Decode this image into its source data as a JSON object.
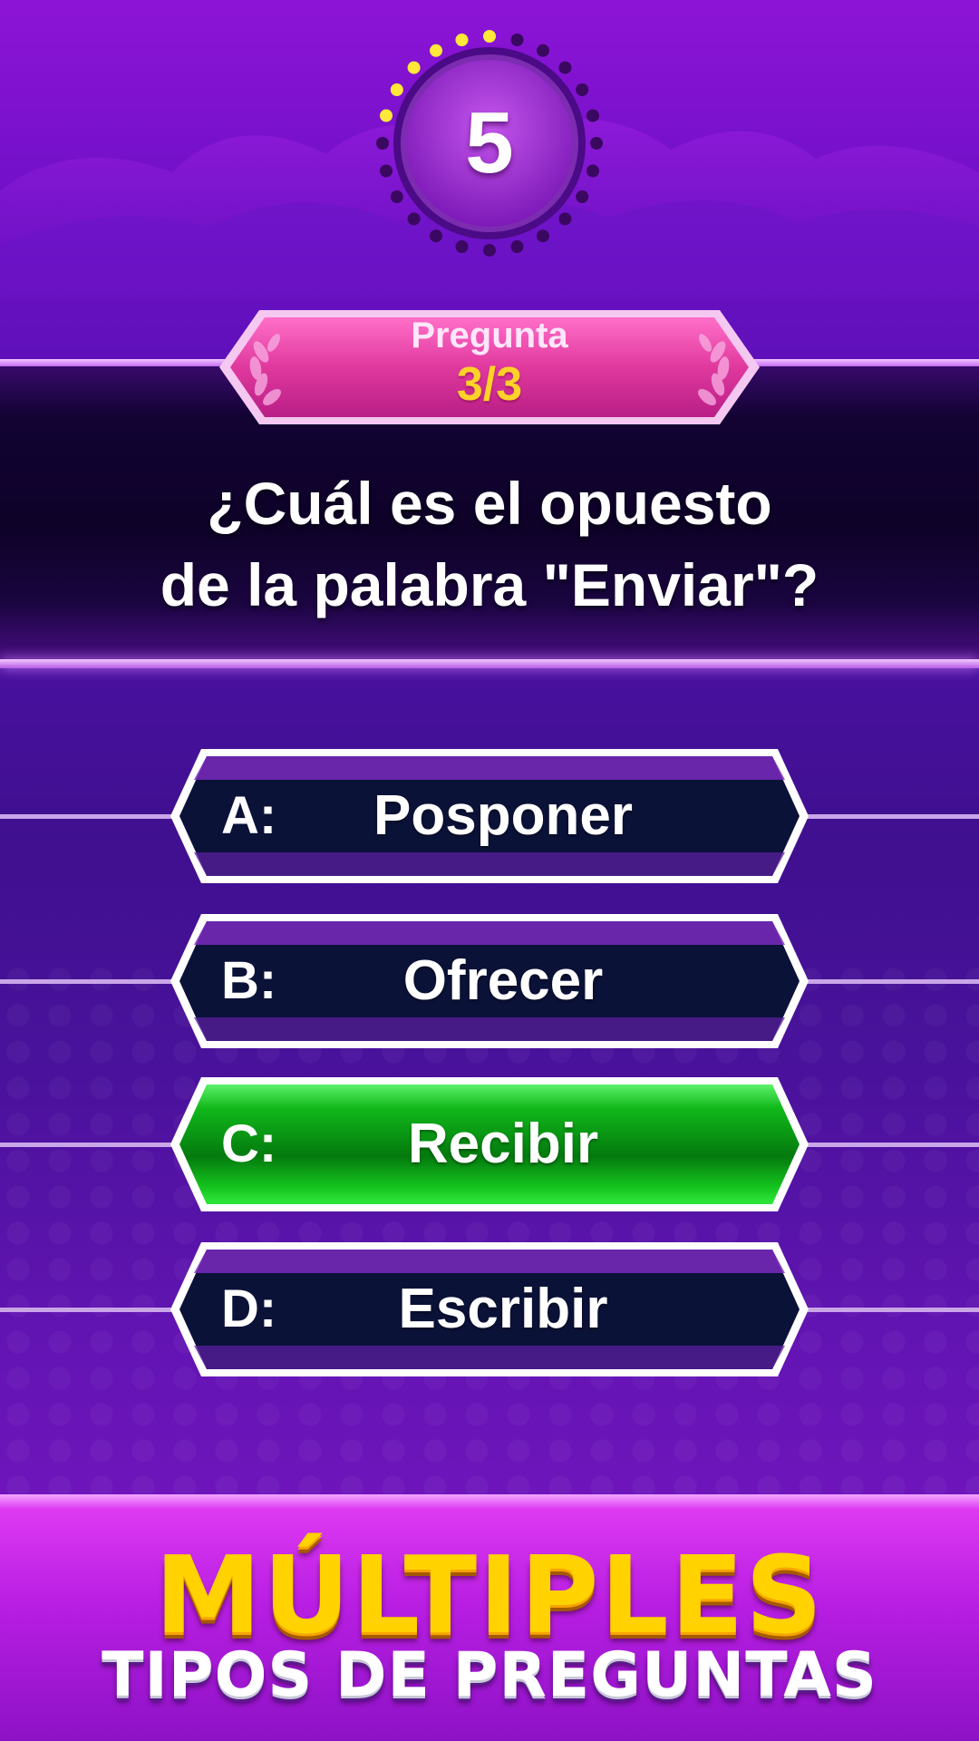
{
  "timer": {
    "value": "5",
    "progress": 0.25
  },
  "question_header": {
    "label": "Pregunta",
    "count": "3/3"
  },
  "question": {
    "line1": "¿Cuál es el opuesto",
    "line2": "de la palabra \"Enviar\"?"
  },
  "answers": [
    {
      "letter": "A:",
      "text": "Posponer",
      "state": "default"
    },
    {
      "letter": "B:",
      "text": "Ofrecer",
      "state": "default"
    },
    {
      "letter": "C:",
      "text": "Recibir",
      "state": "correct"
    },
    {
      "letter": "D:",
      "text": "Escribir",
      "state": "default"
    }
  ],
  "promo": {
    "title": "MÚLTIPLES",
    "subtitle": "TIPOS DE PREGUNTAS"
  },
  "colors": {
    "background": "#5111ac",
    "answer_default": "#0b1238",
    "answer_correct": "#12c21e",
    "question_label": "#e0399e",
    "count_yellow": "#ffd22a",
    "timer_dot_active": "#ffe83a",
    "timer_dot_inactive": "#3a0860"
  }
}
